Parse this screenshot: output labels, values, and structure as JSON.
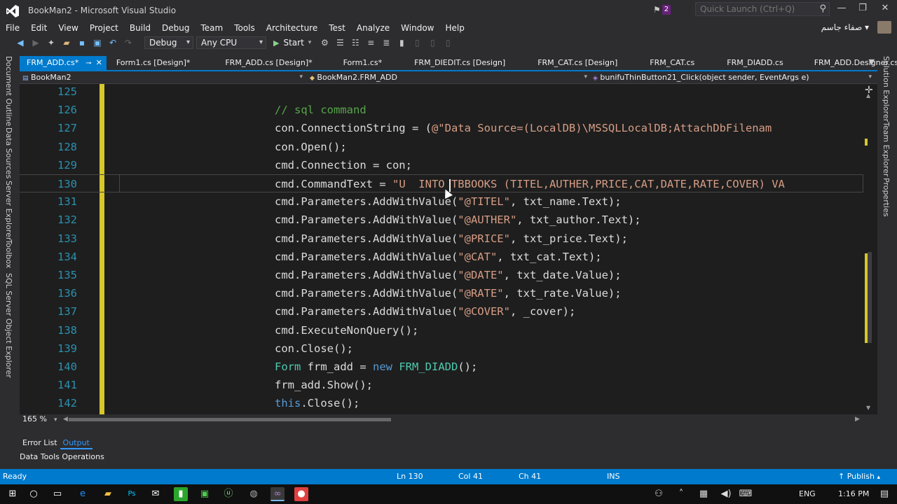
{
  "window": {
    "title": "BookMan2 - Microsoft Visual Studio",
    "notification_count": "2",
    "quick_launch_placeholder": "Quick Launch (Ctrl+Q)"
  },
  "menu": [
    "File",
    "Edit",
    "View",
    "Project",
    "Build",
    "Debug",
    "Team",
    "Tools",
    "Architecture",
    "Test",
    "Analyze",
    "Window",
    "Help"
  ],
  "user": {
    "name": "صفاء جاسم"
  },
  "toolbar": {
    "configuration": "Debug",
    "platform": "Any CPU",
    "start_label": "Start"
  },
  "left_tool_windows": [
    "Document Outline",
    "Data Sources",
    "Server Explorer",
    "Toolbox",
    "SQL Server Object Explorer"
  ],
  "right_tool_windows": [
    "Solution Explorer",
    "Team Explorer",
    "Properties"
  ],
  "doc_tabs": [
    "FRM_ADD.cs*",
    "Form1.cs [Design]*",
    "FRM_ADD.cs [Design]*",
    "Form1.cs*",
    "FRM_DIEDIT.cs [Design]",
    "FRM_CAT.cs [Design]",
    "FRM_CAT.cs",
    "FRM_DIADD.cs",
    "FRM_ADD.Designer.cs"
  ],
  "navbar": {
    "project": "BookMan2",
    "class": "BookMan2.FRM_ADD",
    "member": "bunifuThinButton21_Click(object sender, EventArgs e)"
  },
  "code_lines": [
    {
      "n": "125",
      "tokens": []
    },
    {
      "n": "126",
      "tokens": [
        {
          "t": "// sql command",
          "c": "comment"
        }
      ]
    },
    {
      "n": "127",
      "tokens": [
        {
          "t": "con.ConnectionString = (",
          "c": "plain"
        },
        {
          "t": "@\"Data Source=(LocalDB)\\MSSQLLocalDB;AttachDbFilenam",
          "c": "string"
        }
      ]
    },
    {
      "n": "128",
      "tokens": [
        {
          "t": "con.Open();",
          "c": "plain"
        }
      ]
    },
    {
      "n": "129",
      "tokens": [
        {
          "t": "cmd.Connection = con;",
          "c": "plain"
        }
      ]
    },
    {
      "n": "130",
      "tokens": [
        {
          "t": "cmd.CommandText = ",
          "c": "plain"
        },
        {
          "t": "\"U  INTO TBBOOKS (TITEL,AUTHER,PRICE,CAT,DATE,RATE,COVER) VA",
          "c": "string"
        }
      ]
    },
    {
      "n": "131",
      "tokens": [
        {
          "t": "cmd.Parameters.AddWithValue(",
          "c": "plain"
        },
        {
          "t": "\"@TITEL\"",
          "c": "string"
        },
        {
          "t": ", txt_name.Text);",
          "c": "plain"
        }
      ]
    },
    {
      "n": "132",
      "tokens": [
        {
          "t": "cmd.Parameters.AddWithValue(",
          "c": "plain"
        },
        {
          "t": "\"@AUTHER\"",
          "c": "string"
        },
        {
          "t": ", txt_author.Text);",
          "c": "plain"
        }
      ]
    },
    {
      "n": "133",
      "tokens": [
        {
          "t": "cmd.Parameters.AddWithValue(",
          "c": "plain"
        },
        {
          "t": "\"@PRICE\"",
          "c": "string"
        },
        {
          "t": ", txt_price.Text);",
          "c": "plain"
        }
      ]
    },
    {
      "n": "134",
      "tokens": [
        {
          "t": "cmd.Parameters.AddWithValue(",
          "c": "plain"
        },
        {
          "t": "\"@CAT\"",
          "c": "string"
        },
        {
          "t": ", txt_cat.Text);",
          "c": "plain"
        }
      ]
    },
    {
      "n": "135",
      "tokens": [
        {
          "t": "cmd.Parameters.AddWithValue(",
          "c": "plain"
        },
        {
          "t": "\"@DATE\"",
          "c": "string"
        },
        {
          "t": ", txt_date.Value);",
          "c": "plain"
        }
      ]
    },
    {
      "n": "136",
      "tokens": [
        {
          "t": "cmd.Parameters.AddWithValue(",
          "c": "plain"
        },
        {
          "t": "\"@RATE\"",
          "c": "string"
        },
        {
          "t": ", txt_rate.Value);",
          "c": "plain"
        }
      ]
    },
    {
      "n": "137",
      "tokens": [
        {
          "t": "cmd.Parameters.AddWithValue(",
          "c": "plain"
        },
        {
          "t": "\"@COVER\"",
          "c": "string"
        },
        {
          "t": ", _cover);",
          "c": "plain"
        }
      ]
    },
    {
      "n": "138",
      "tokens": [
        {
          "t": "cmd.ExecuteNonQuery();",
          "c": "plain"
        }
      ]
    },
    {
      "n": "139",
      "tokens": [
        {
          "t": "con.Close();",
          "c": "plain"
        }
      ]
    },
    {
      "n": "140",
      "tokens": [
        {
          "t": "Form",
          "c": "type"
        },
        {
          "t": " frm_add = ",
          "c": "plain"
        },
        {
          "t": "new",
          "c": "kw"
        },
        {
          "t": " ",
          "c": "plain"
        },
        {
          "t": "FRM_DIADD",
          "c": "type"
        },
        {
          "t": "();",
          "c": "plain"
        }
      ]
    },
    {
      "n": "141",
      "tokens": [
        {
          "t": "frm_add.Show();",
          "c": "plain"
        }
      ]
    },
    {
      "n": "142",
      "tokens": [
        {
          "t": "this",
          "c": "kw"
        },
        {
          "t": ".Close();",
          "c": "plain"
        }
      ]
    }
  ],
  "current_line": "130",
  "editor": {
    "zoom": "165 %"
  },
  "panel": {
    "tabs": [
      "Error List",
      "Output"
    ],
    "active_tab": "Output",
    "sub_label": "Data Tools Operations"
  },
  "status": {
    "state": "Ready",
    "ln": "Ln 130",
    "col": "Col 41",
    "ch": "Ch 41",
    "mode": "INS",
    "publish": "Publish"
  },
  "taskbar": {
    "language": "ENG",
    "time": "1:16 PM"
  },
  "colors": {
    "accent": "#007acc",
    "comment": "#57a64a",
    "string": "#d69d85",
    "keyword": "#569cd6",
    "type": "#4ec9b0",
    "line_number": "#2b91af"
  }
}
